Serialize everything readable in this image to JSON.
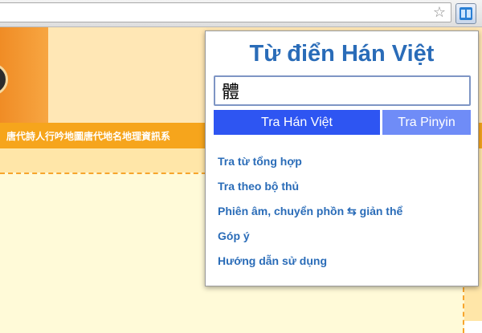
{
  "browser": {
    "star_icon": "star-icon",
    "extension_icon": "book-icon"
  },
  "page": {
    "banner_text": "唐代詩人行吟地圖唐代地名地理資訊系"
  },
  "popup": {
    "title": "Từ điển Hán Việt",
    "input_value": "體",
    "buttons": {
      "hanviet": "Tra Hán Việt",
      "pinyin": "Tra Pinyin"
    },
    "links": [
      "Tra từ tổng hợp",
      "Tra theo bộ thủ",
      "Phiên âm, chuyển phồn ⇆ giản thể",
      "Góp ý",
      "Hướng dẫn sử dụng"
    ]
  },
  "colors": {
    "title_blue": "#2a6cb8",
    "primary_button": "#2e55f2",
    "secondary_button": "#6f8cf7",
    "banner_orange": "#f6a51c"
  }
}
